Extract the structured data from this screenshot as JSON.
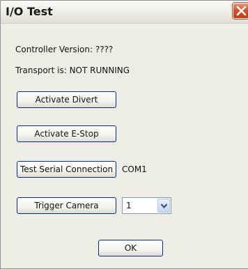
{
  "window": {
    "title": "I/O Test"
  },
  "icons": {
    "close": "close-x-icon",
    "dropdown": "chevron-down-icon"
  },
  "status": {
    "controller_version": "Controller Version: ????",
    "transport": "Transport is: NOT RUNNING"
  },
  "buttons": {
    "activate_divert": "Activate Divert",
    "activate_estop": "Activate E-Stop",
    "test_serial": "Test Serial Connection",
    "trigger_camera": "Trigger Camera",
    "ok": "OK"
  },
  "serial_port": "COM1",
  "camera_select": {
    "value": "1"
  },
  "colors": {
    "close_button": "#c94a22",
    "button_border": "#0a2a7e",
    "dialog_bg": "#efeee6"
  }
}
